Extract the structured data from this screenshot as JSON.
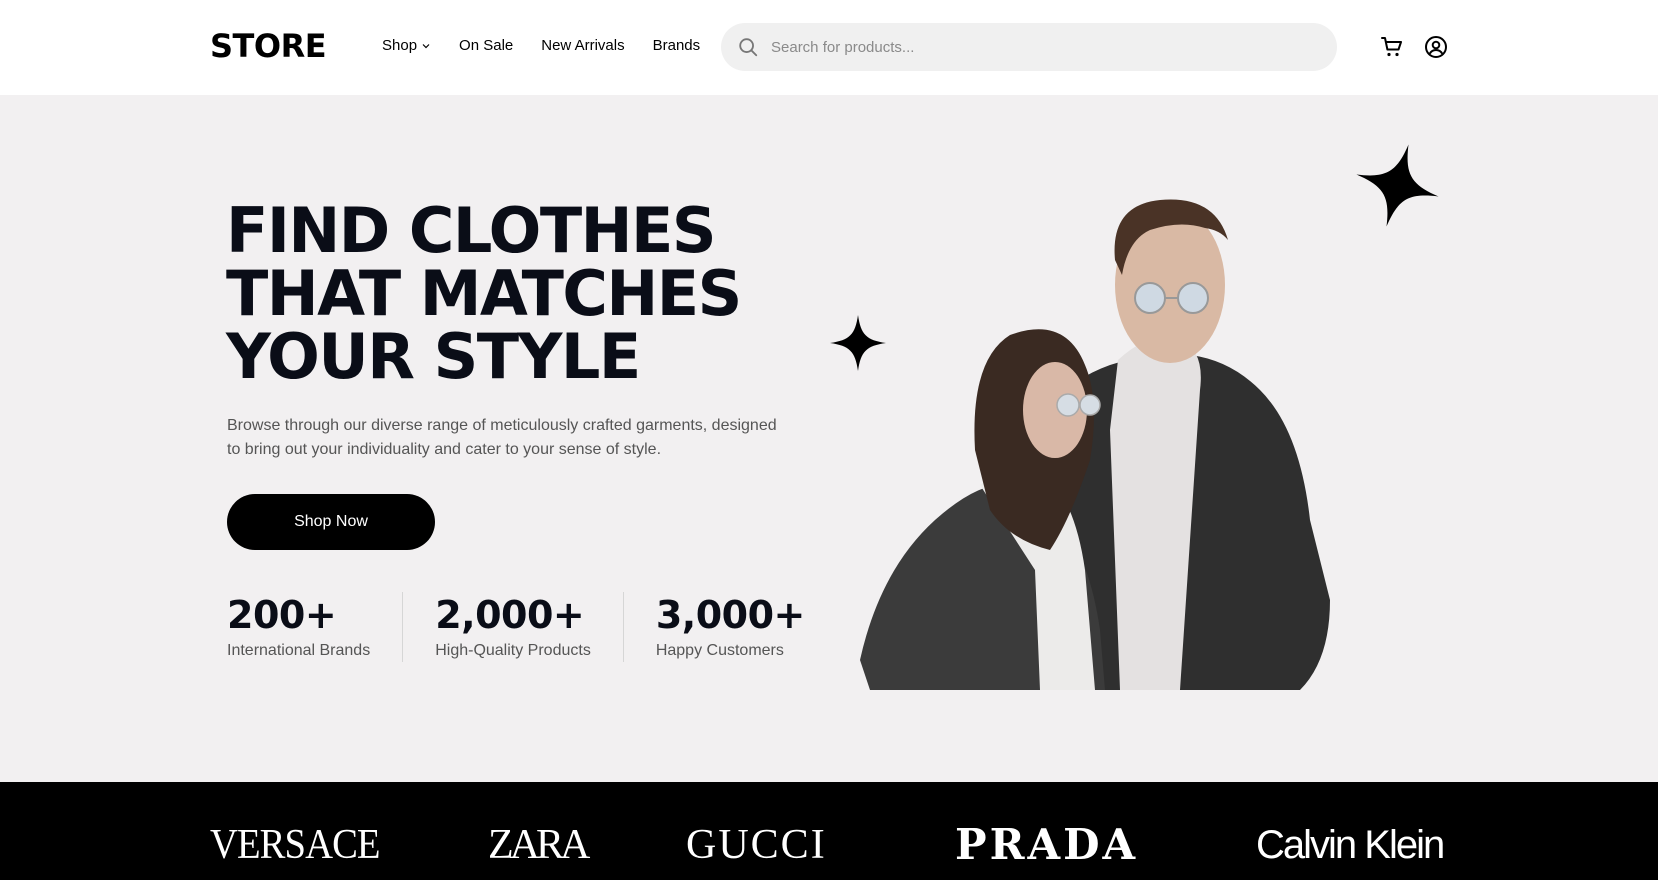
{
  "header": {
    "logo": "STORE",
    "nav": [
      {
        "label": "Shop",
        "has_dropdown": true
      },
      {
        "label": "On Sale"
      },
      {
        "label": "New Arrivals"
      },
      {
        "label": "Brands"
      }
    ],
    "search": {
      "placeholder": "Search for products...",
      "value": "",
      "icon": "search-icon"
    },
    "icons": [
      "cart-icon",
      "user-icon"
    ]
  },
  "hero": {
    "title_lines": [
      "FIND CLOTHES",
      "THAT MATCHES",
      "YOUR STYLE"
    ],
    "description": "Browse through our diverse range of meticulously crafted garments, designed to bring out your individuality and cater to your sense of style.",
    "cta_label": "Shop Now",
    "stats": [
      {
        "value": "200+",
        "label": "International Brands"
      },
      {
        "value": "2,000+",
        "label": "High-Quality Products"
      },
      {
        "value": "3,000+",
        "label": "Happy Customers"
      }
    ]
  },
  "brands": [
    "VERSACE",
    "ZARA",
    "GUCCI",
    "PRADA",
    "Calvin Klein"
  ],
  "colors": {
    "hero_bg": "#f2f0f1",
    "primary": "#000000",
    "title": "#0a0d17",
    "muted_text": "#555555",
    "search_bg": "#f0f0f0"
  }
}
